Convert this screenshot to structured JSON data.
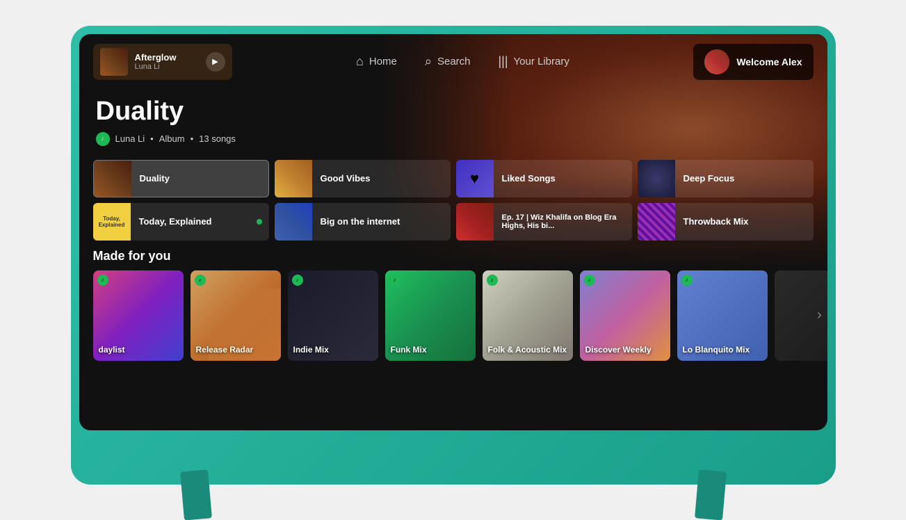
{
  "tv": {
    "background_color": "#2dbfa8"
  },
  "header": {
    "now_playing": {
      "title": "Afterglow",
      "artist": "Luna Li",
      "play_icon": "▶"
    },
    "nav": [
      {
        "id": "home",
        "label": "Home",
        "icon": "⌂",
        "active": false
      },
      {
        "id": "search",
        "label": "Search",
        "icon": "🔍",
        "active": false
      },
      {
        "id": "library",
        "label": "Your Library",
        "icon": "𝄀",
        "active": false
      }
    ],
    "user": {
      "greeting": "Welcome Alex"
    }
  },
  "hero": {
    "title": "Duality",
    "artist": "Luna Li",
    "type": "Album",
    "songs": "13 songs"
  },
  "quick_picks": [
    {
      "id": "duality",
      "label": "Duality",
      "thumb_type": "duality",
      "active": true
    },
    {
      "id": "goodvibes",
      "label": "Good Vibes",
      "thumb_type": "goodvibes",
      "active": false
    },
    {
      "id": "liked",
      "label": "Liked Songs",
      "thumb_type": "liked",
      "active": false
    },
    {
      "id": "deepfocus",
      "label": "Deep Focus",
      "thumb_type": "deepfocus",
      "active": false
    },
    {
      "id": "today",
      "label": "Today, Explained",
      "thumb_type": "today",
      "active": false,
      "has_dot": true
    },
    {
      "id": "biginternet",
      "label": "Big on the internet",
      "thumb_type": "biginternet",
      "active": false
    },
    {
      "id": "wiz",
      "label": "Ep. 17 | Wiz Khalifa on Blog Era Highs, His bi...",
      "thumb_type": "wiz",
      "active": false
    },
    {
      "id": "throwback",
      "label": "Throwback Mix",
      "thumb_type": "throwback",
      "active": false
    }
  ],
  "made_for_you": {
    "section_title": "Made for you",
    "cards": [
      {
        "id": "daylist",
        "label": "daylist",
        "bg_type": "daylist"
      },
      {
        "id": "release",
        "label": "Release Radar",
        "bg_type": "release"
      },
      {
        "id": "indie",
        "label": "Indie Mix",
        "bg_type": "indie"
      },
      {
        "id": "funk",
        "label": "Funk Mix",
        "bg_type": "funk"
      },
      {
        "id": "folk",
        "label": "Folk & Acoustic Mix",
        "bg_type": "folk"
      },
      {
        "id": "discover",
        "label": "Discover Weekly",
        "bg_type": "discover"
      },
      {
        "id": "loblanquito",
        "label": "Lo Blanquito Mix",
        "bg_type": "loblanquito"
      },
      {
        "id": "more",
        "label": "...",
        "bg_type": "more"
      }
    ]
  }
}
